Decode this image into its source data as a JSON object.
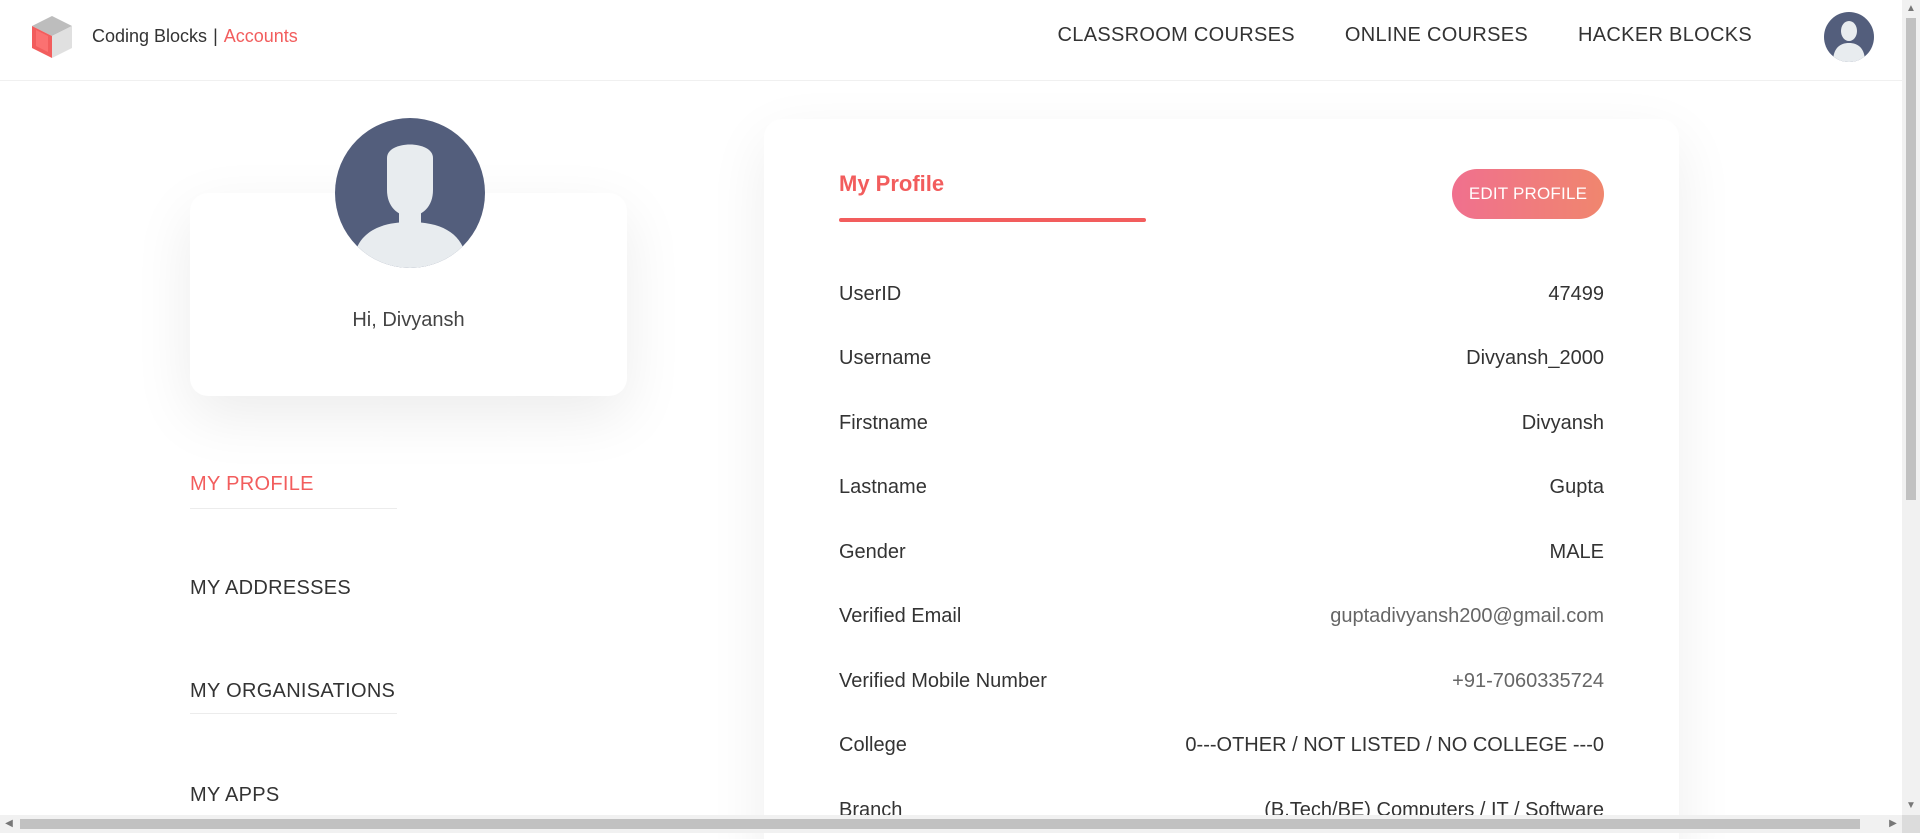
{
  "header": {
    "brand_name": "Coding Blocks",
    "brand_separator": "|",
    "brand_section": "Accounts",
    "nav": [
      {
        "label": "CLASSROOM COURSES"
      },
      {
        "label": "ONLINE COURSES"
      },
      {
        "label": "HACKER BLOCKS"
      }
    ]
  },
  "sidebar": {
    "greeting": "Hi, Divyansh",
    "items": [
      {
        "label": "MY PROFILE",
        "active": true
      },
      {
        "label": "MY ADDRESSES"
      },
      {
        "label": "MY ORGANISATIONS"
      },
      {
        "label": "MY APPS"
      }
    ]
  },
  "profile": {
    "title": "My Profile",
    "edit_label": "EDIT PROFILE",
    "fields": [
      {
        "label": "UserID",
        "value": "47499"
      },
      {
        "label": "Username",
        "value": "Divyansh_2000"
      },
      {
        "label": "Firstname",
        "value": "Divyansh"
      },
      {
        "label": "Lastname",
        "value": "Gupta"
      },
      {
        "label": "Gender",
        "value": "MALE"
      },
      {
        "label": "Verified Email",
        "value": "guptadivyansh200@gmail.com"
      },
      {
        "label": "Verified Mobile Number",
        "value": "+91-7060335724"
      },
      {
        "label": "College",
        "value": "0---OTHER / NOT LISTED / NO COLLEGE ---0"
      },
      {
        "label": "Branch",
        "value": "(B.Tech/BE) Computers / IT / Software"
      }
    ]
  },
  "colors": {
    "accent": "#f25d5d",
    "avatar_bg": "#535e7c",
    "button_gradient_start": "#f0708e",
    "button_gradient_end": "#f0866e"
  }
}
